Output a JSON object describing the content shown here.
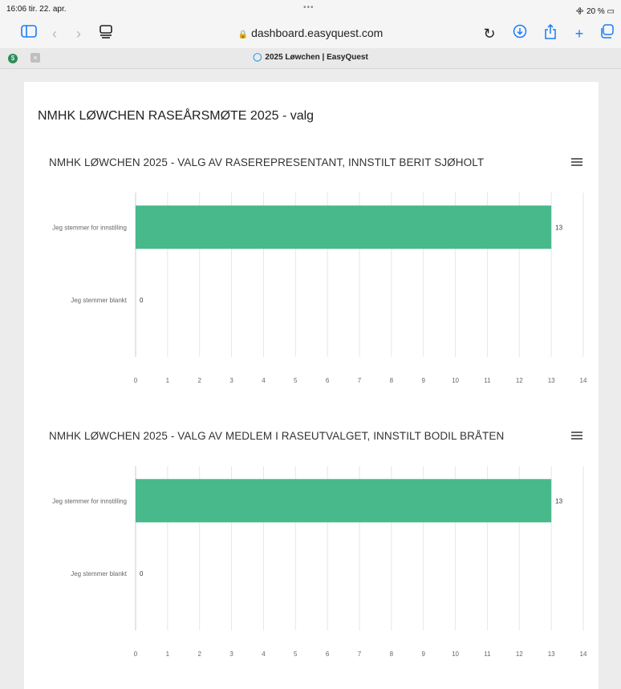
{
  "statusbar": {
    "time": "16:06  tir. 22. apr.",
    "dots": "•••",
    "battery": "20 %"
  },
  "browser": {
    "url": "dashboard.easyquest.com",
    "tab_title": "2025 Løwchen | EasyQuest",
    "icons": [
      "sidebar-icon",
      "back-icon",
      "forward-icon",
      "reader-icon",
      "reload-icon",
      "download-icon",
      "share-icon",
      "new-tab-icon",
      "tabs-icon"
    ]
  },
  "page": {
    "title": "NMHK LØWCHEN RASEÅRSMØTE 2025 - valg"
  },
  "colors": {
    "bar": "#47b98b",
    "grid": "#e6e6e6",
    "label": "#666666"
  },
  "chart_data": [
    {
      "type": "bar",
      "orientation": "horizontal",
      "title": "NMHK LØWCHEN 2025 - VALG AV RASEREPRESENTANT, INNSTILT BERIT SJØHOLT",
      "categories": [
        "Jeg stemmer for innstilling",
        "Jeg stemmer blankt"
      ],
      "values": [
        13,
        0
      ],
      "xlim": [
        0,
        14
      ],
      "xticks": [
        0,
        1,
        2,
        3,
        4,
        5,
        6,
        7,
        8,
        9,
        10,
        11,
        12,
        13,
        14
      ],
      "grid": true
    },
    {
      "type": "bar",
      "orientation": "horizontal",
      "title": "NMHK LØWCHEN 2025 - VALG AV MEDLEM I RASEUTVALGET, INNSTILT BODIL BRÅTEN",
      "categories": [
        "Jeg stemmer for innstilling",
        "Jeg stemmer blankt"
      ],
      "values": [
        13,
        0
      ],
      "xlim": [
        0,
        14
      ],
      "xticks": [
        0,
        1,
        2,
        3,
        4,
        5,
        6,
        7,
        8,
        9,
        10,
        11,
        12,
        13,
        14
      ],
      "grid": true
    }
  ]
}
